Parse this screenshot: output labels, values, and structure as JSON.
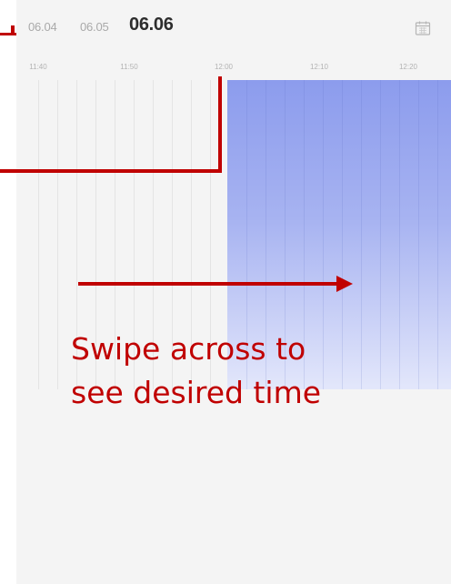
{
  "date_tabs": [
    {
      "label": "06.04",
      "active": false
    },
    {
      "label": "06.05",
      "active": false
    },
    {
      "label": "06.06",
      "active": true
    }
  ],
  "calendar_icon": "calendar-icon",
  "timeline": {
    "ticks": [
      "11:40",
      "11:50",
      "12:00",
      "12:10",
      "12:20"
    ],
    "selected_start": "12:00"
  },
  "annotation": {
    "instruction_line1": "Swipe across to",
    "instruction_line2": "see desired time",
    "color": "#c00000"
  },
  "colors": {
    "selection_top": "#8c9ced",
    "selection_bottom": "#e3e7fb",
    "panel_background": "#f4f4f4"
  }
}
